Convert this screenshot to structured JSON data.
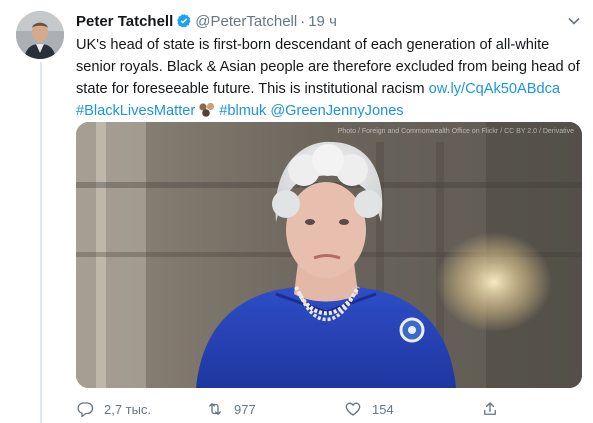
{
  "tweet": {
    "author_name": "Peter Tatchell",
    "handle": "@PeterTatchell",
    "separator": "·",
    "time": "19 ч",
    "text_line1": "UK's head of state is first-born descendant of each generation of all-white",
    "text_line2": "senior royals. Black & Asian people are therefore excluded from being head of",
    "text_line3": "state for foreseeable future. This is institutional racism ",
    "link": "ow.ly/CqAk50ABdca",
    "hashtag1": "#BlackLivesMatter",
    "hashtag2": "#blmuk",
    "mention": "@GreenJennyJones",
    "media_credit": "Photo / Foreign and Commonwealth Office on Flickr / CC BY 2.0 / Derivative"
  },
  "actions": {
    "reply_count": "2,7 тыс.",
    "retweet_count": "977",
    "like_count": "154"
  },
  "icons": {
    "verified": "verified-badge-icon",
    "caret": "chevron-down-icon",
    "reply": "reply-icon",
    "retweet": "retweet-icon",
    "like": "like-icon",
    "share": "share-icon",
    "emoji": "hands-emoji-icon"
  },
  "colors": {
    "link": "#1b95e0",
    "secondary_text": "#657786",
    "verified": "#1da1f2"
  }
}
